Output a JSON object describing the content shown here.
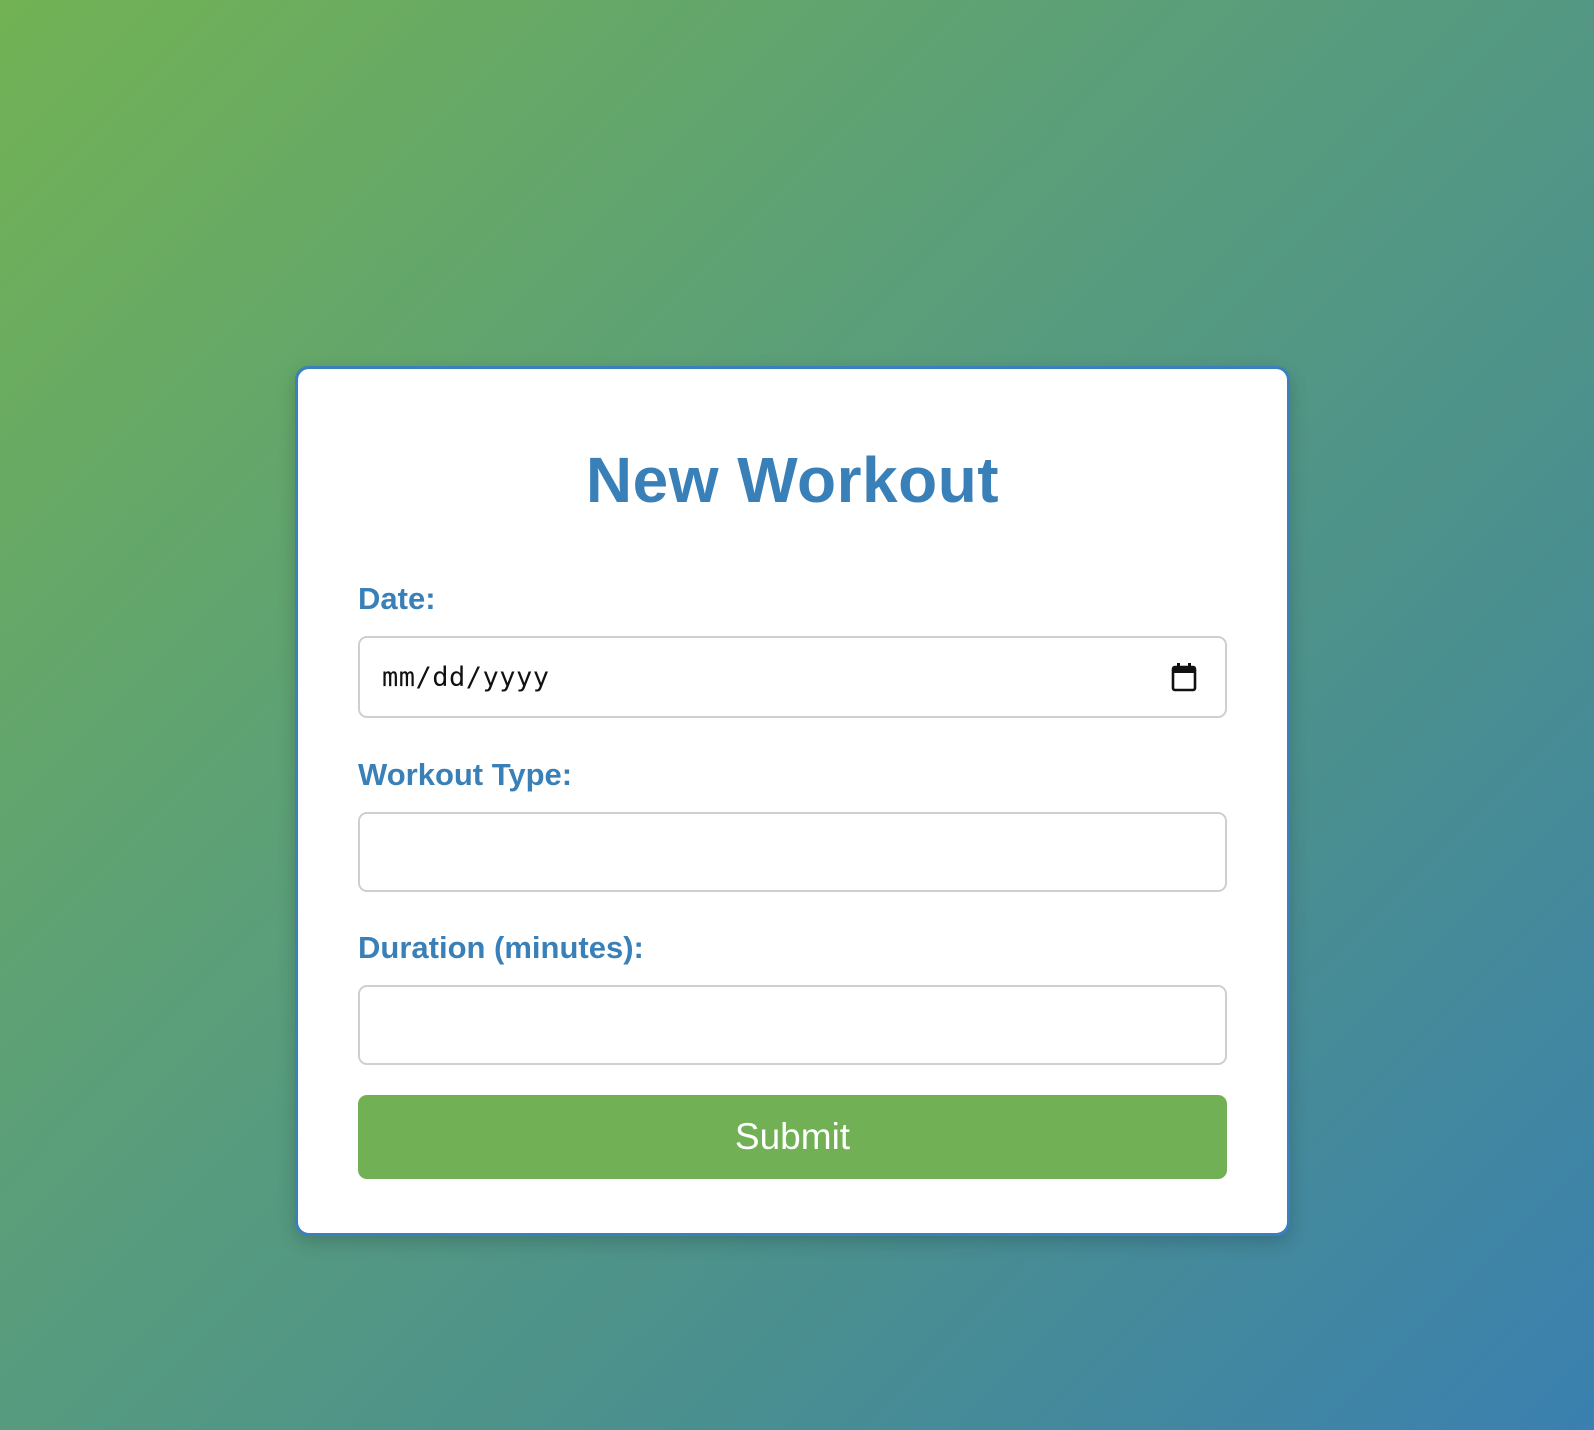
{
  "form": {
    "title": "New Workout",
    "fields": {
      "date": {
        "label": "Date:",
        "value": "",
        "placeholder": "mm/dd/yyyy",
        "icon": "calendar-icon"
      },
      "workout_type": {
        "label": "Workout Type:",
        "value": ""
      },
      "duration": {
        "label": "Duration (minutes):",
        "value": ""
      }
    },
    "submit_label": "Submit"
  },
  "colors": {
    "accent": "#3a80b8",
    "button": "#72b055",
    "background_start": "#72b254",
    "background_end": "#3a80b0"
  }
}
